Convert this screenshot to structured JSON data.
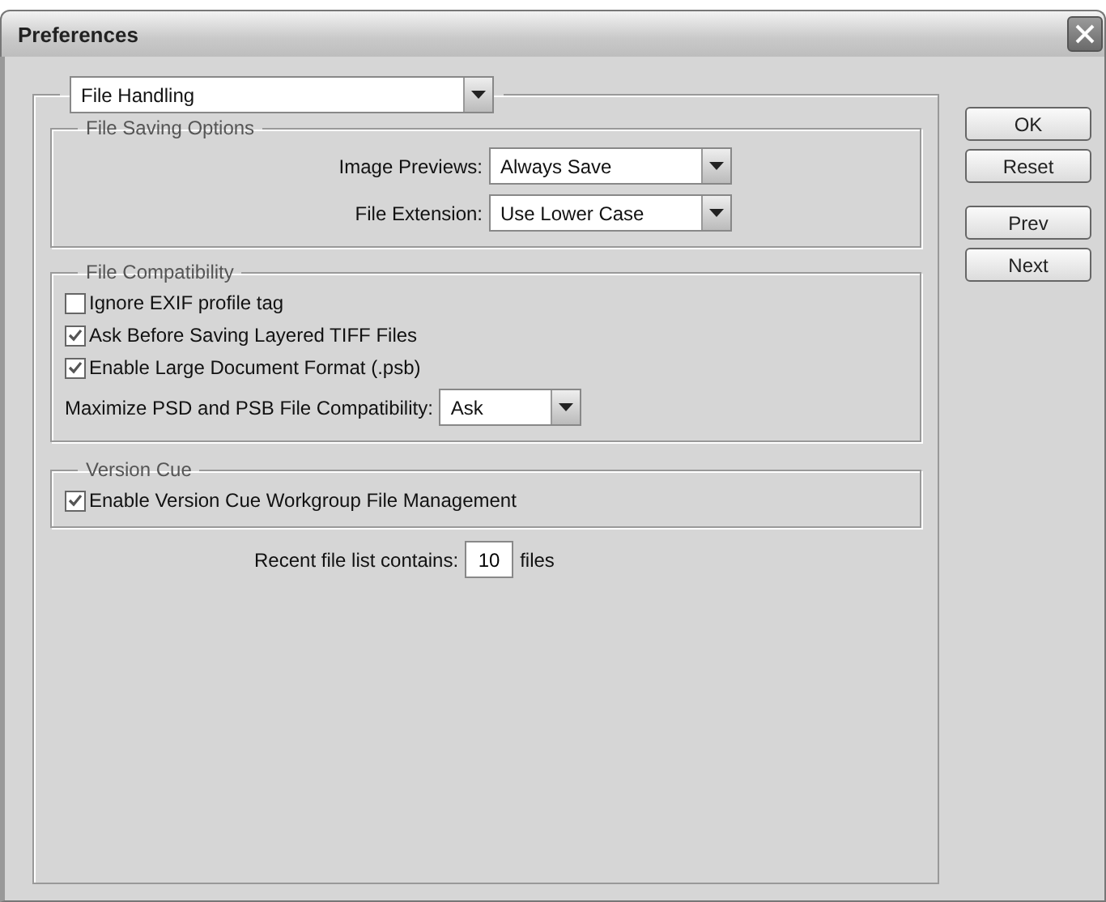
{
  "window": {
    "title": "Preferences"
  },
  "category": {
    "value": "File Handling"
  },
  "file_saving": {
    "title": "File Saving Options",
    "fields": [
      {
        "label": "Image Previews:",
        "value": "Always Save"
      },
      {
        "label": "File Extension:",
        "value": "Use Lower Case"
      }
    ]
  },
  "file_compatibility": {
    "title": "File Compatibility",
    "checkboxes": [
      {
        "label": "Ignore EXIF profile tag",
        "checked": false
      },
      {
        "label": "Ask Before Saving Layered TIFF Files",
        "checked": true
      },
      {
        "label": "Enable Large Document Format (.psb)",
        "checked": true
      }
    ],
    "maximize": {
      "label": "Maximize PSD and PSB File Compatibility:",
      "value": "Ask"
    }
  },
  "version_cue": {
    "title": "Version Cue",
    "checkboxes": [
      {
        "label": "Enable Version Cue Workgroup File Management",
        "checked": true
      }
    ]
  },
  "recent_files": {
    "label": "Recent file list contains:",
    "value": "10",
    "unit": "files"
  },
  "buttons": [
    "OK",
    "Reset",
    "Prev",
    "Next"
  ]
}
